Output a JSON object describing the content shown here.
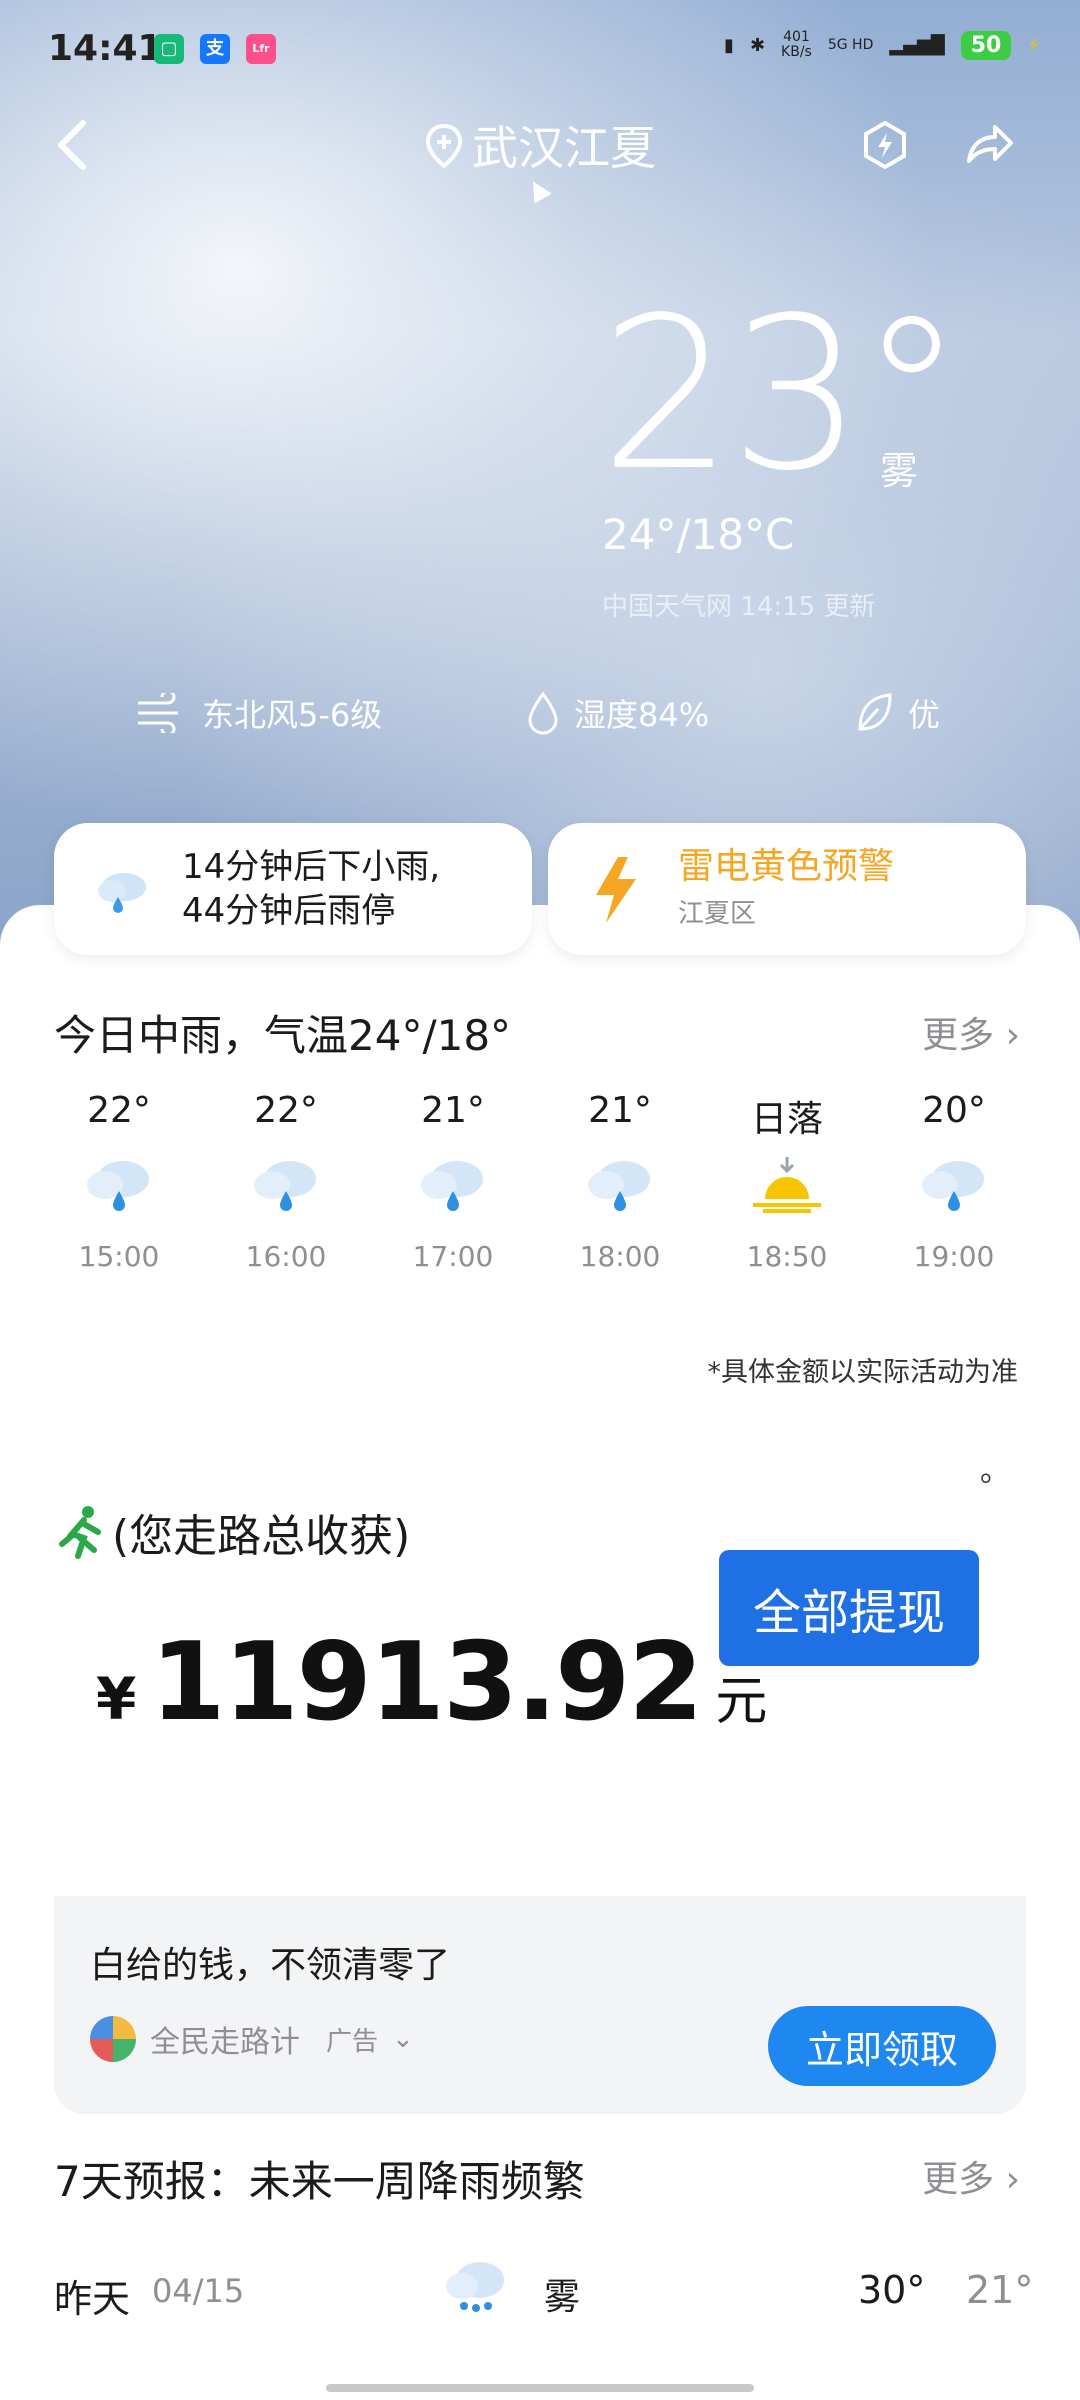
{
  "status_bar": {
    "time": "14:41",
    "net_speed": "401\nKB/s",
    "network": "5G HD",
    "battery": "50"
  },
  "header": {
    "location": "武汉江夏"
  },
  "current": {
    "temperature": "23°",
    "condition": "雾",
    "range": "24°/18°C",
    "source": "中国天气网 14:15 更新"
  },
  "metrics": {
    "wind": "东北风5-6级",
    "humidity": "湿度84%",
    "air_quality": "优"
  },
  "cards": {
    "rain_line1": "14分钟后下小雨,",
    "rain_line2": "44分钟后雨停",
    "warning_title": "雷电黄色预警",
    "warning_area": "江夏区"
  },
  "today": {
    "title": "今日中雨，气温24°/18°",
    "more": "更多",
    "hours": [
      {
        "temp": "22°",
        "time": "15:00",
        "icon": "rain-icon"
      },
      {
        "temp": "22°",
        "time": "16:00",
        "icon": "rain-icon"
      },
      {
        "temp": "21°",
        "time": "17:00",
        "icon": "rain-icon"
      },
      {
        "temp": "21°",
        "time": "18:00",
        "icon": "rain-icon"
      },
      {
        "temp": "日落",
        "time": "18:50",
        "icon": "sunset-icon"
      },
      {
        "temp": "20°",
        "time": "19:00",
        "icon": "rain-icon"
      }
    ]
  },
  "ad": {
    "note": "*具体金额以实际活动为准",
    "dot": "。",
    "earn_label": "(您走路总收获)",
    "currency": "¥",
    "amount": "11913.92",
    "unit": "元",
    "withdraw": "全部提现",
    "headline": "白给的钱，不领清零了",
    "brand": "全民走路计",
    "ad_tag": "广告",
    "claim": "立即领取"
  },
  "forecast": {
    "title": "7天预报：未来一周降雨频繁",
    "more": "更多",
    "days": [
      {
        "day": "昨天",
        "date": "04/15",
        "condition": "雾",
        "high": "30°",
        "low": "21°"
      }
    ]
  },
  "colors": {
    "accent_blue": "#1f6fe5",
    "claim_blue": "#1e88f0",
    "warning_orange": "#f5a623",
    "sunset_yellow": "#f7c400"
  }
}
